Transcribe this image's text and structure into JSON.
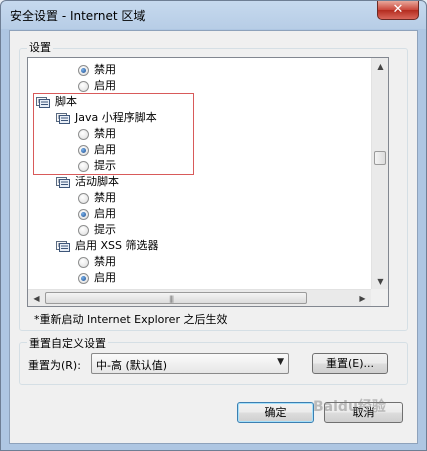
{
  "window": {
    "title": "安全设置 - Internet 区域",
    "close_glyph": "✕"
  },
  "settings_group": {
    "label": "设置"
  },
  "tree": [
    {
      "kind": "radio",
      "label": "禁用",
      "checked": true,
      "indent": 2
    },
    {
      "kind": "radio",
      "label": "启用",
      "checked": false,
      "indent": 2
    },
    {
      "kind": "folder",
      "label": "脚本",
      "indent": 0
    },
    {
      "kind": "folder",
      "label": "Java 小程序脚本",
      "indent": 1
    },
    {
      "kind": "radio",
      "label": "禁用",
      "checked": false,
      "indent": 2
    },
    {
      "kind": "radio",
      "label": "启用",
      "checked": true,
      "indent": 2
    },
    {
      "kind": "radio",
      "label": "提示",
      "checked": false,
      "indent": 2
    },
    {
      "kind": "folder",
      "label": "活动脚本",
      "indent": 1
    },
    {
      "kind": "radio",
      "label": "禁用",
      "checked": false,
      "indent": 2
    },
    {
      "kind": "radio",
      "label": "启用",
      "checked": true,
      "indent": 2
    },
    {
      "kind": "radio",
      "label": "提示",
      "checked": false,
      "indent": 2
    },
    {
      "kind": "folder",
      "label": "启用 XSS 筛选器",
      "indent": 1
    },
    {
      "kind": "radio",
      "label": "禁用",
      "checked": false,
      "indent": 2
    },
    {
      "kind": "radio",
      "label": "启用",
      "checked": true,
      "indent": 2
    }
  ],
  "note": "*重新启动 Internet Explorer 之后生效",
  "reset_group": {
    "label": "重置自定义设置",
    "reset_to_label": "重置为(R):",
    "selected": "中-高 (默认值)",
    "reset_button": "重置(E)..."
  },
  "buttons": {
    "ok": "确定",
    "cancel": "取消"
  },
  "watermark": "Baidu经验",
  "colors": {
    "highlight_box": "#d85a5a",
    "title_gradient": "#b7cde6",
    "close": "#c9463a"
  }
}
